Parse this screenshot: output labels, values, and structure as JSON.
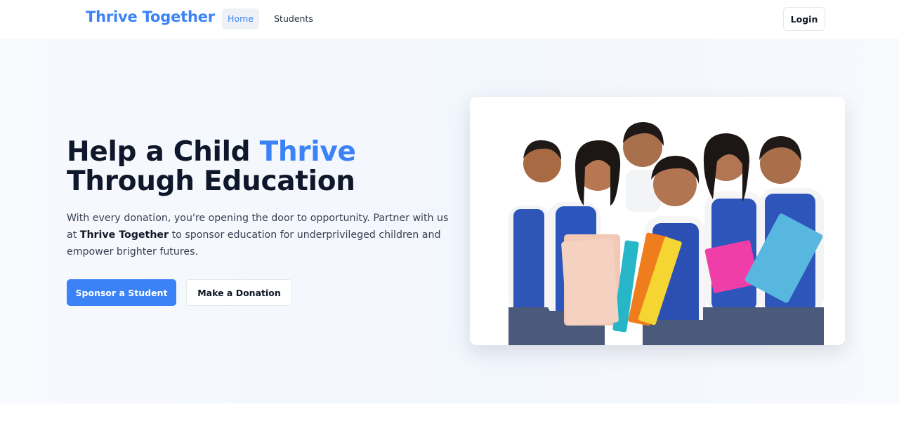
{
  "header": {
    "brand": "Thrive Together",
    "nav": [
      {
        "label": "Home",
        "active": true
      },
      {
        "label": "Students",
        "active": false
      }
    ],
    "login_label": "Login"
  },
  "hero": {
    "title_part1": "Help a Child ",
    "title_accent": "Thrive",
    "title_line2": "Through Education",
    "description_part1": "With every donation, you're opening the door to opportunity. Partner with us at ",
    "description_bold": "Thrive Together",
    "description_part2": " to sponsor education for underprivileged children and empower brighter futures.",
    "primary_cta": "Sponsor a Student",
    "secondary_cta": "Make a Donation"
  },
  "colors": {
    "accent": "#3b82f6",
    "text_dark": "#0f172a",
    "hero_bg": "#f2f6fd"
  },
  "image": {
    "subject": "group-of-schoolchildren-photo"
  }
}
